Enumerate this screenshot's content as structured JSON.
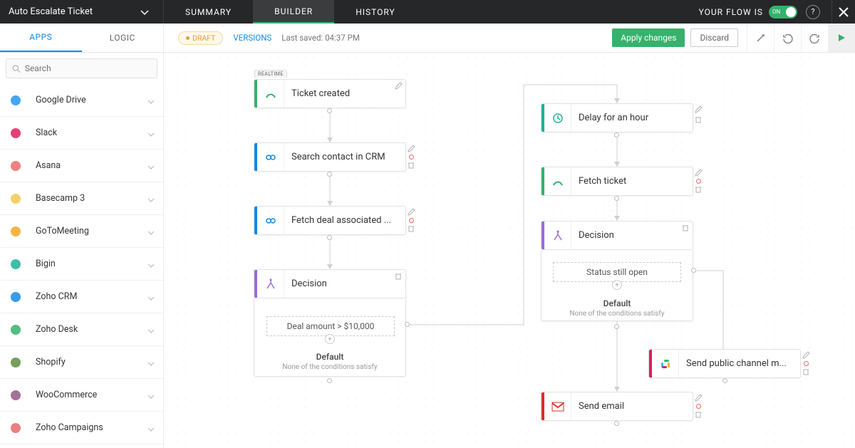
{
  "header": {
    "flow_title": "Auto Escalate Ticket",
    "tabs": {
      "summary": "SUMMARY",
      "builder": "BUILDER",
      "history": "HISTORY"
    },
    "flow_status_label": "YOUR FLOW IS",
    "toggle_label": "ON"
  },
  "toolbar": {
    "sub_tabs": {
      "apps": "APPS",
      "logic": "LOGIC"
    },
    "draft_label": "DRAFT",
    "versions_label": "VERSIONS",
    "last_saved": "Last saved: 04:37 PM",
    "apply_label": "Apply changes",
    "discard_label": "Discard"
  },
  "sidebar": {
    "search_placeholder": "Search",
    "apps": [
      {
        "name": "Google Drive",
        "color": "#2196f3"
      },
      {
        "name": "Slack",
        "color": "#e01e5a"
      },
      {
        "name": "Asana",
        "color": "#f06a6a"
      },
      {
        "name": "Basecamp 3",
        "color": "#f2c94c"
      },
      {
        "name": "GoToMeeting",
        "color": "#f5a623"
      },
      {
        "name": "Bigin",
        "color": "#1fb199"
      },
      {
        "name": "Zoho CRM",
        "color": "#1389e5"
      },
      {
        "name": "Zoho Desk",
        "color": "#35b26c"
      },
      {
        "name": "Shopify",
        "color": "#5e8e3e"
      },
      {
        "name": "WooCommerce",
        "color": "#96588a"
      },
      {
        "name": "Zoho Campaigns",
        "color": "#e86a6a"
      }
    ]
  },
  "canvas": {
    "nodes": {
      "ticket_created": {
        "label": "Ticket created",
        "realtime": "REALTIME",
        "accent": "#35b26c"
      },
      "search_contact": {
        "label": "Search contact in CRM",
        "accent": "#1389e5"
      },
      "fetch_deal": {
        "label": "Fetch deal associated ...",
        "accent": "#1389e5"
      },
      "decision1": {
        "label": "Decision",
        "accent": "#9a6dd7"
      },
      "cond_deal": {
        "label": "Deal amount > $10,000"
      },
      "default1": {
        "title": "Default",
        "sub": "None of the conditions satisfy"
      },
      "delay_hour": {
        "label": "Delay for an hour",
        "accent": "#1fb199"
      },
      "fetch_ticket": {
        "label": "Fetch ticket",
        "accent": "#35b26c"
      },
      "decision2": {
        "label": "Decision",
        "accent": "#9a6dd7"
      },
      "cond_status": {
        "label": "Status still open"
      },
      "default2": {
        "title": "Default",
        "sub": "None of the conditions satisfy"
      },
      "slack_msg": {
        "label": "Send public channel m...",
        "accent": "#e01e5a"
      },
      "send_email": {
        "label": "Send email",
        "accent": "#d93025"
      }
    }
  }
}
